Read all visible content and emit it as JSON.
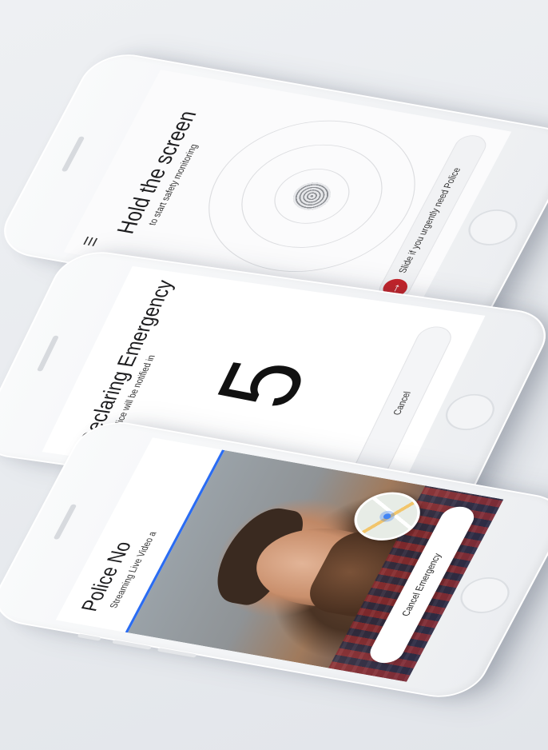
{
  "hold_screen": {
    "menu_icon": "hamburger-menu-icon",
    "title": "Hold the screen",
    "subtitle": "to start safety monitoring",
    "fingerprint_icon": "fingerprint-icon",
    "slide_icon": "arrow-right-icon",
    "slide_label": "Slide if you urgently need Police",
    "accent_color": "#c4242b"
  },
  "declaring_screen": {
    "title": "Declaring Emergency",
    "subtitle": "Police will be notified in",
    "countdown": "5",
    "cancel_label": "Cancel"
  },
  "police_screen": {
    "title": "Police No",
    "subtitle": "Streaming Live Video a",
    "accent_color": "#2a6cf2",
    "map_icon": "location-map-icon",
    "cancel_label": "Cancel Emergency"
  }
}
